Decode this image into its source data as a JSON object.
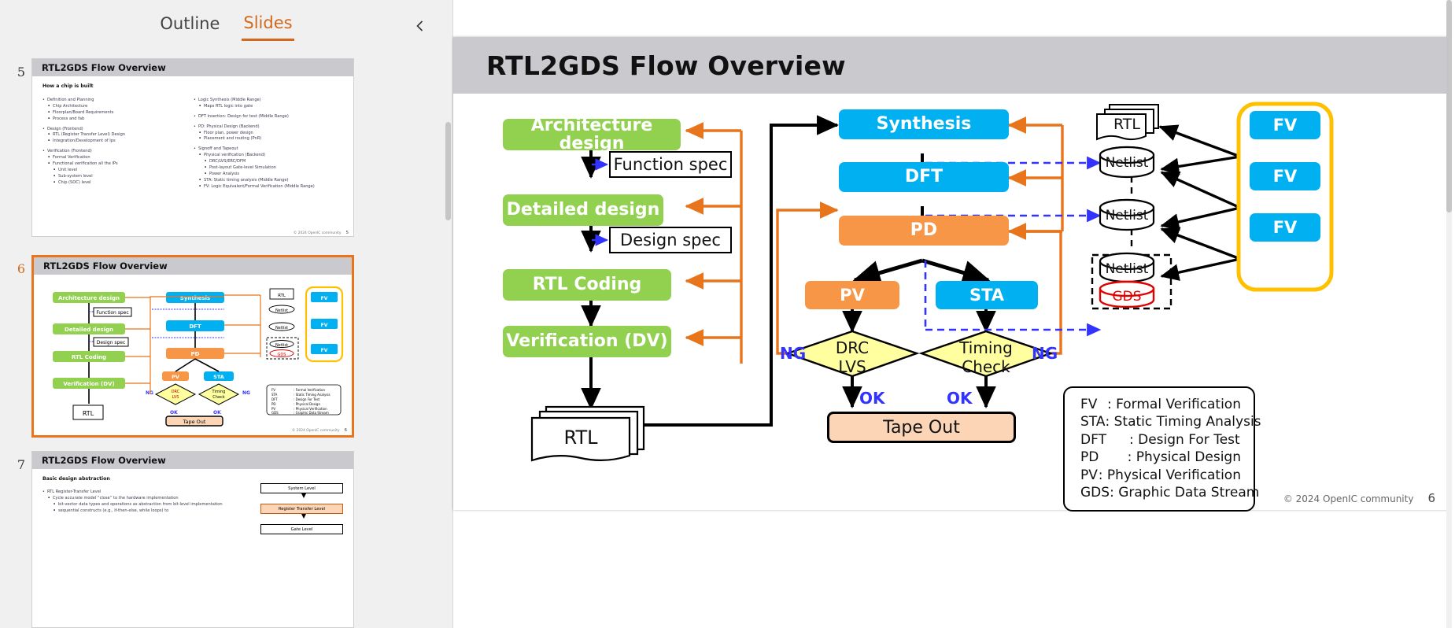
{
  "left_panel": {
    "tabs": [
      {
        "label": "Outline",
        "active": false
      },
      {
        "label": "Slides",
        "active": true
      }
    ],
    "collapse_icon": "chevron-left-icon",
    "thumbnails": [
      {
        "number": "5",
        "title": "RTL2GDS Flow Overview",
        "selected": false,
        "heading": "How a chip is built",
        "footer": "© 2024 OpenIC community",
        "page": "5",
        "left_column": [
          {
            "text": "Definition and Planning",
            "level": 1
          },
          {
            "text": "Chip Architecture",
            "level": 2
          },
          {
            "text": "Floorplan/Board Requirements",
            "level": 2
          },
          {
            "text": "Process and fab",
            "level": 2
          },
          {
            "text": "",
            "level": 0
          },
          {
            "text": "Design (Frontend)",
            "level": 1
          },
          {
            "text": "RTL (Register Transfer Level) Design",
            "level": 2
          },
          {
            "text": "Integration/Development of Ips",
            "level": 2
          },
          {
            "text": "",
            "level": 0
          },
          {
            "text": "Verification (Frontend)",
            "level": 1
          },
          {
            "text": "Formal Verification",
            "level": 2
          },
          {
            "text": "Functional verification all the IPs",
            "level": 2
          },
          {
            "text": "Unit level",
            "level": 3
          },
          {
            "text": "Sub-system level",
            "level": 3
          },
          {
            "text": "Chip (SOC) level",
            "level": 3
          }
        ],
        "right_column": [
          {
            "text": "Logic Synthesis (Middle Range)",
            "level": 1
          },
          {
            "text": "Maps RTL logic into gate",
            "level": 2
          },
          {
            "text": "",
            "level": 0
          },
          {
            "text": "DFT insertion: Design for test (Middle Range)",
            "level": 1
          },
          {
            "text": "",
            "level": 0
          },
          {
            "text": "PD: Physical Design (Backend)",
            "level": 1
          },
          {
            "text": "Floor plan, power design",
            "level": 2
          },
          {
            "text": "Placement and routing (PnR)",
            "level": 2
          },
          {
            "text": "",
            "level": 0
          },
          {
            "text": "Signoff and Tapeout",
            "level": 1
          },
          {
            "text": "Physical verification (Backend)",
            "level": 2
          },
          {
            "text": "DRC/LVS/ERC/DFM",
            "level": 3
          },
          {
            "text": "Post-layout Gate-level Simulation",
            "level": 3
          },
          {
            "text": "Power Analysis",
            "level": 3
          },
          {
            "text": "STA: Static timing analysis (Middle Range)",
            "level": 2
          },
          {
            "text": "FV: Logic Equivalent/Formal Verification (Middle Range)",
            "level": 2
          }
        ]
      },
      {
        "number": "6",
        "title": "RTL2GDS Flow Overview",
        "selected": true,
        "footer": "© 2024 OpenIC community",
        "page": "6"
      },
      {
        "number": "7",
        "title": "RTL2GDS Flow Overview",
        "selected": false,
        "heading": "Basic design abstraction",
        "bullets": [
          {
            "text": "RTL Register-Transfer Level",
            "level": 1
          },
          {
            "text": "Cycle accurate model “close” to the hardware implementation",
            "level": 2
          },
          {
            "text": "bit-vector data types and operations as abstraction from bit-level implementation",
            "level": 3
          },
          {
            "text": "sequential constructs (e.g., if-then-else, while loops) to",
            "level": 3
          }
        ],
        "stack": [
          {
            "label": "System Level",
            "highlight": false
          },
          {
            "label": "Register Transfer Level",
            "highlight": true
          },
          {
            "label": "Gate Level",
            "highlight": false
          }
        ]
      }
    ]
  },
  "slide": {
    "title": "RTL2GDS Flow Overview",
    "footer": "© 2024 OpenIC community",
    "page_number": "6",
    "flow_left": [
      {
        "name": "architecture-design",
        "label": "Architecture design",
        "color": "#92d050"
      },
      {
        "name": "detailed-design",
        "label": "Detailed design",
        "color": "#92d050"
      },
      {
        "name": "rtl-coding",
        "label": "RTL Coding",
        "color": "#92d050"
      },
      {
        "name": "verification-dv",
        "label": "Verification (DV)",
        "color": "#92d050"
      }
    ],
    "spec_docs": [
      {
        "name": "function-spec",
        "label": "Function spec"
      },
      {
        "name": "design-spec",
        "label": "Design spec"
      }
    ],
    "rtl_doc_label": "RTL",
    "flow_right": [
      {
        "name": "synthesis",
        "label": "Synthesis",
        "color": "#00b0f0"
      },
      {
        "name": "dft",
        "label": "DFT",
        "color": "#00b0f0"
      },
      {
        "name": "pd",
        "label": "PD",
        "color": "#f79646"
      }
    ],
    "branch": [
      {
        "name": "pv",
        "label": "PV",
        "color": "#f79646"
      },
      {
        "name": "sta",
        "label": "STA",
        "color": "#00b0f0"
      }
    ],
    "decisions": [
      {
        "name": "drc-lvs",
        "label_line1": "DRC",
        "label_line2": "LVS",
        "ng": "NG",
        "ok": "OK"
      },
      {
        "name": "timing-check",
        "label_line1": "Timing",
        "label_line2": "Check",
        "ng": "NG",
        "ok": "OK"
      }
    ],
    "tape_out": "Tape Out",
    "data_stack": [
      {
        "name": "rtl-doc",
        "label": "RTL",
        "kind": "document"
      },
      {
        "name": "netlist-1",
        "label": "Netlist",
        "kind": "cylinder"
      },
      {
        "name": "netlist-2",
        "label": "Netlist",
        "kind": "cylinder"
      },
      {
        "name": "netlist-3",
        "label": "Netlist",
        "kind": "cylinder"
      },
      {
        "name": "gds",
        "label": "GDS",
        "kind": "cylinder",
        "color": "#e00000"
      }
    ],
    "fv_boxes": [
      {
        "name": "fv-1",
        "label": "FV"
      },
      {
        "name": "fv-2",
        "label": "FV"
      },
      {
        "name": "fv-3",
        "label": "FV"
      }
    ],
    "legend": [
      {
        "abbr": "FV",
        "definition": ": Formal Verification"
      },
      {
        "abbr": "STA",
        "definition": ": Static Timing Analysis"
      },
      {
        "abbr": "DFT",
        "definition": ": Design For Test"
      },
      {
        "abbr": "PD",
        "definition": ": Physical Design"
      },
      {
        "abbr": "PV",
        "definition": ": Physical Verification"
      },
      {
        "abbr": "GDS",
        "definition": ": Graphic Data Stream"
      }
    ],
    "colors": {
      "green": "#92d050",
      "blue": "#00b0f0",
      "orange": "#f79646",
      "yellow_diamond": "#ffffa0",
      "feedback_arrow": "#e8741c",
      "dashed_blue": "#3333ff",
      "fv_group_border": "#ffc000",
      "tape_out_fill": "#fbd5b5",
      "title_bar": "#c9c9ce"
    }
  }
}
